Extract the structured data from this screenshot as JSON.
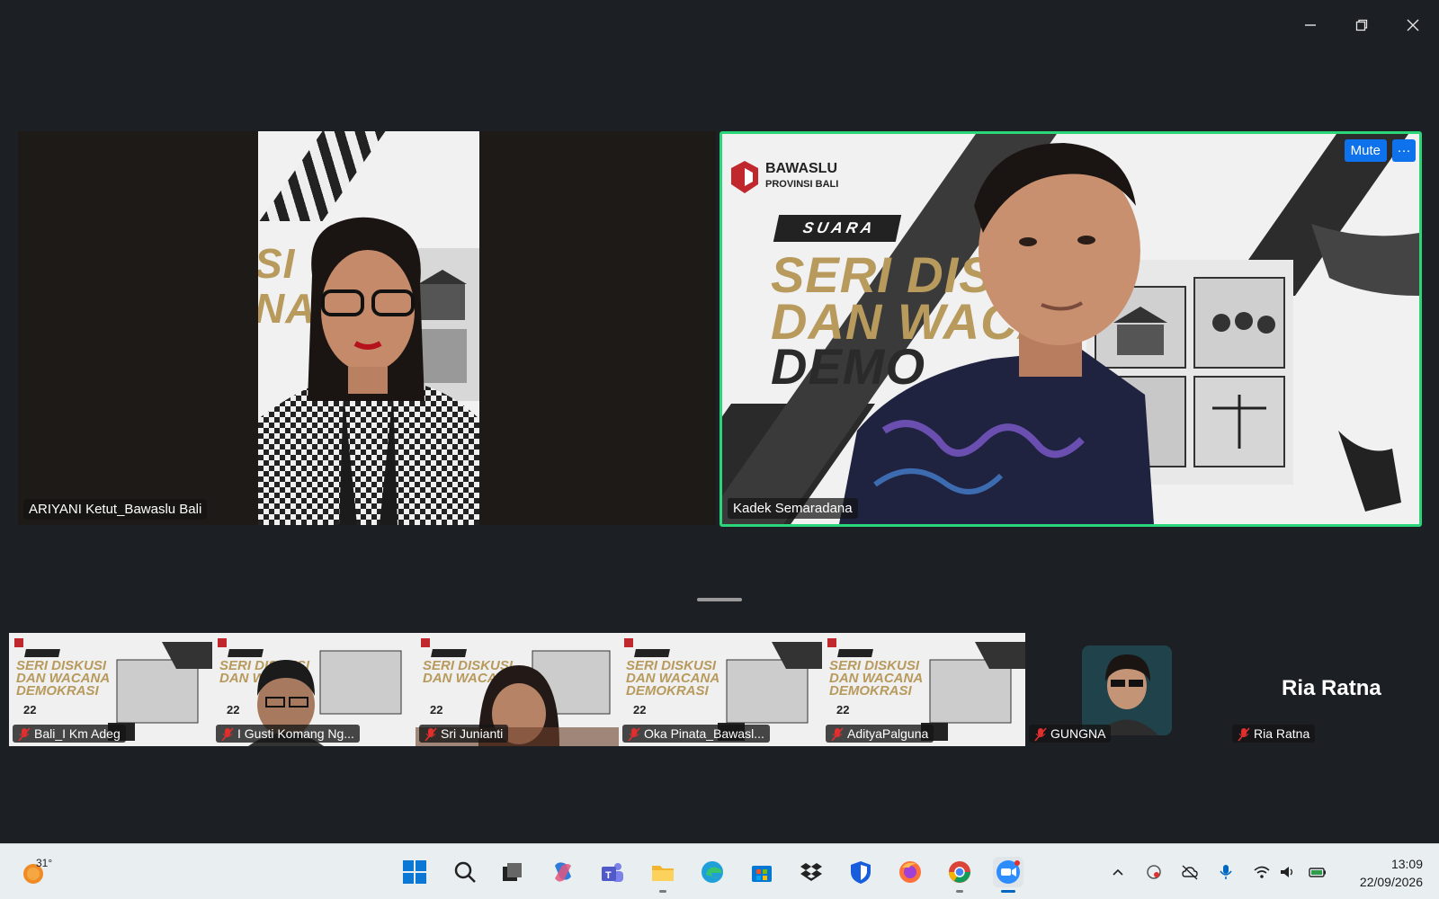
{
  "window": {
    "controls": [
      "minimize",
      "restore",
      "close"
    ]
  },
  "gallery": {
    "main_tiles": [
      {
        "name": "ARIYANI Ketut_Bawaslu Bali"
      },
      {
        "name": "Kadek Semaradana",
        "active_speaker": true,
        "mute_label": "Mute",
        "more_label": "···"
      }
    ],
    "banner": {
      "org_name": "BAWASLU",
      "org_sub": "PROVINSI BALI",
      "suara": "SUARA",
      "title_line1": "SERI DISKU",
      "title_line2": "DAN WACA",
      "title_line3": "DEMO",
      "partial_title1": "SI",
      "partial_title2": "NA"
    },
    "thumbnails": [
      {
        "name": "Bali_I Km Adeg",
        "mic_muted": true
      },
      {
        "name": "I Gusti Komang Ng...",
        "mic_muted": true
      },
      {
        "name": "Sri Junianti",
        "mic_muted": true
      },
      {
        "name": "Oka Pinata_Bawasl...",
        "mic_muted": true
      },
      {
        "name": "AdityaPalguna",
        "mic_muted": true
      },
      {
        "name": "GUNGNA",
        "mic_muted": true
      },
      {
        "name": "Ria Ratna",
        "mic_muted": true,
        "display_name": "Ria Ratna"
      }
    ],
    "thumb_banner": {
      "line1": "SERI DISKUSI",
      "line2": "DAN WACANA",
      "line3": "DEMOKRASI",
      "date": "22"
    }
  },
  "taskbar": {
    "weather_temp": "31°",
    "apps": [
      "windows-start",
      "search",
      "task-view",
      "copilot",
      "teams",
      "file-explorer",
      "edge",
      "store",
      "dropbox",
      "bitwarden",
      "firefox",
      "chrome",
      "zoom"
    ],
    "clock_time": "13:09",
    "clock_date": "22/09/2026"
  },
  "colors": {
    "active_border": "#2bd67b",
    "accent_blue": "#0e72ed",
    "banner_gold": "#b79a5c",
    "background": "#1c1f24"
  }
}
